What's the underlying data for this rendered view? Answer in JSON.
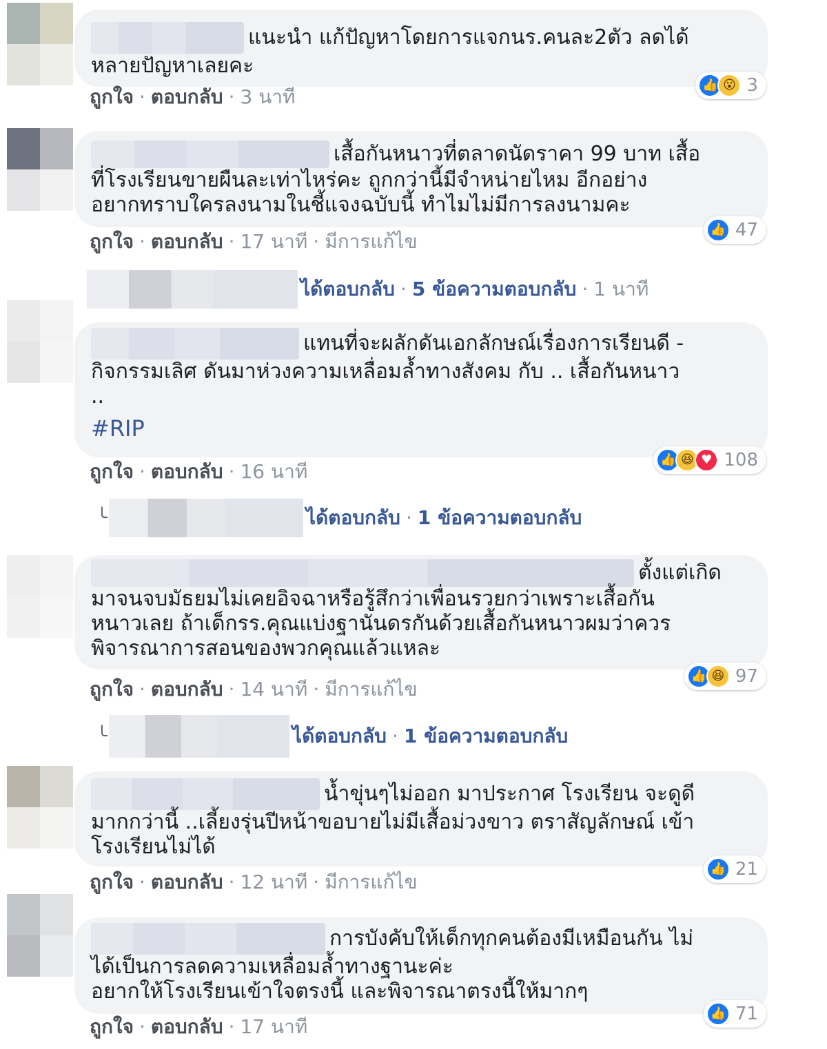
{
  "colors": {
    "bubble": "#f2f3f5",
    "link": "#385898",
    "meta": "#606770",
    "like": "#1877f2"
  },
  "labels": {
    "like": "ถูกใจ",
    "reply": "ตอบกลับ",
    "edited": "มีการแก้ไข",
    "dot": "·",
    "replied": "ได้ตอบกลับ"
  },
  "comments": [
    {
      "text": "แนะนำ แก้ปัญหาโดยการแจกนร.คนละ2ตัว ลดได้\nหลายปัญหาเลยคะ",
      "reactions": [
        "like-icon",
        "wow-icon"
      ],
      "reaction_count": "3",
      "time": "3 นาที"
    },
    {
      "text": "เสื้อกันหนาวที่ตลาดนัดราคา 99 บาท เสื้อ\nที่โรงเรียนขายผืนละเท่าไหร่คะ ถูกกว่านี้มีจำหน่ายไหม อีกอย่าง\nอยากทราบใครลงนามในชี้แจงฉบับนี้ ทำไมไม่มีการลงนามคะ",
      "reactions": [
        "like-icon"
      ],
      "reaction_count": "47",
      "time": "17 นาที",
      "edited": true,
      "replies_summary": "5 ข้อความตอบกลับ",
      "replies_time": "1 นาที"
    },
    {
      "text": "แทนที่จะผลักดันเอกลักษณ์เรื่องการเรียนดี -\nกิจกรรมเลิศ ดันมาห่วงความเหลื่อมล้ำทางสังคม กับ .. เสื้อกันหนาว\n..",
      "hashtag": "#RIP",
      "reactions": [
        "like-icon",
        "haha-icon",
        "love-icon"
      ],
      "reaction_count": "108",
      "time": "16 นาที",
      "replies_summary": "1 ข้อความตอบกลับ"
    },
    {
      "text": "ตั้งแต่เกิด\nมาจนจบมัธยมไม่เคยอิจฉาหรือรู้สึกว่าเพื่อนรวยกว่าเพราะเสื้อกัน\nหนาวเลย ถ้าเด็กรร.คุณแบ่งฐานันดรกันด้วยเสื้อกันหนาวผมว่าควร\nพิจารณาการสอนของพวกคุณแล้วแหละ",
      "reactions": [
        "like-icon",
        "haha-icon"
      ],
      "reaction_count": "97",
      "time": "14 นาที",
      "edited": true,
      "replies_summary": "1 ข้อความตอบกลับ"
    },
    {
      "text": "น้ำขุ่นๆไม่ออก มาประกาศ โรงเรียน จะดูดี\nมากกว่านี้ ..เลี้ยงรุ่นปีหน้าขอบายไม่มีเสื้อม่วงขาว ตราสัญลักษณ์ เข้า\nโรงเรียนไม่ได้",
      "reactions": [
        "like-icon"
      ],
      "reaction_count": "21",
      "time": "12 นาที",
      "edited": true
    },
    {
      "text": "การบังคับให้เด็กทุกคนต้องมีเหมือนกัน ไม่\nได้เป็นการลดความเหลื่อมล้ำทางฐานะค่ะ\nอยากให้โรงเรียนเข้าใจตรงนี้ และพิจารณาตรงนี้ให้มากๆ",
      "reactions": [
        "like-icon"
      ],
      "reaction_count": "71",
      "time": "17 นาที"
    }
  ]
}
